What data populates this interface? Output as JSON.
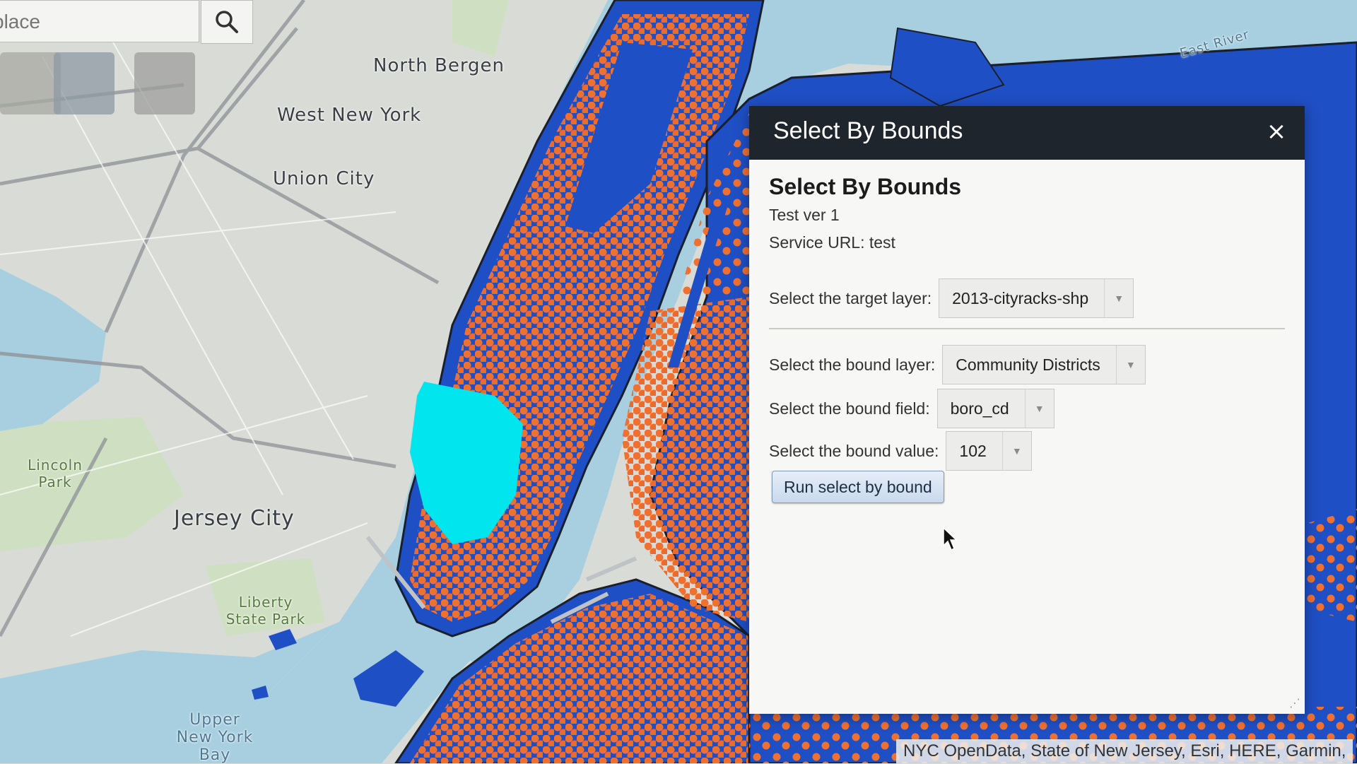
{
  "search": {
    "placeholder": "place"
  },
  "map_labels": {
    "north_bergen": "North Bergen",
    "west_new_york": "West New York",
    "union_city": "Union City",
    "jersey_city": "Jersey City",
    "liberty_state_park": "Liberty State Park",
    "lincoln_park": "Lincoln Park",
    "upper_new_york_bay": "Upper New York Bay",
    "east_river": "East River"
  },
  "dialog": {
    "header_title": "Select By Bounds",
    "close": "×",
    "heading": "Select By Bounds",
    "version": "Test ver 1",
    "service_url": "Service URL: test",
    "target_layer_label": "Select the target layer:",
    "target_layer_value": "2013-cityracks-shp",
    "bound_layer_label": "Select the bound layer:",
    "bound_layer_value": "Community Districts",
    "bound_field_label": "Select the bound field:",
    "bound_field_value": "boro_cd",
    "bound_value_label": "Select the bound value:",
    "bound_value_value": "102",
    "run_button": "Run select by bound"
  },
  "attribution": "NYC OpenData, State of New Jersey, Esri, HERE, Garmin,",
  "colors": {
    "water": "#a8cfe0",
    "land": "#d9dcd6",
    "district_fill": "#1f4fc4",
    "district_outline": "#1a1f2b",
    "point": "#f07030",
    "selection": "#00e5ee",
    "dialog_header": "#1f252c"
  }
}
